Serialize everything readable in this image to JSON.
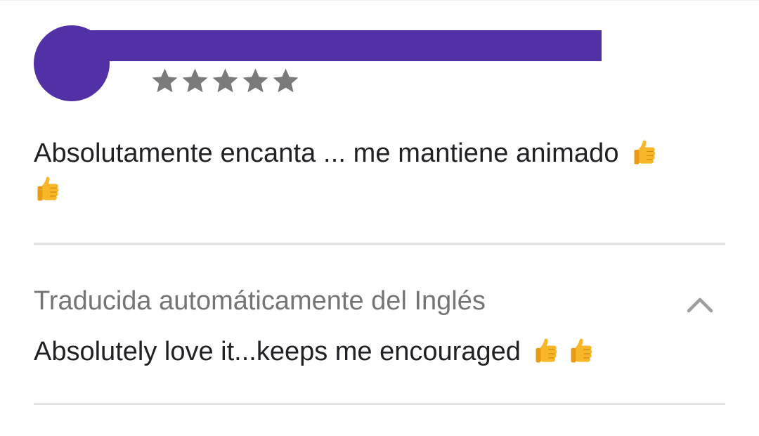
{
  "review": {
    "rating": 5,
    "rating_max": 5,
    "star_color": "#7a7a7a",
    "author_placeholder_color": "#5230a6",
    "text": "Absolutamente encanta ... me mantiene animado",
    "text_emojis": [
      "thumbs-up-icon",
      "thumbs-up-icon"
    ]
  },
  "translation": {
    "label": "Traducida automáticamente del Inglés",
    "original_text": "Absolutely love it...keeps me encouraged",
    "original_emojis": [
      "thumbs-up-icon",
      "thumbs-up-icon"
    ],
    "collapse_icon": "chevron-up-icon"
  }
}
